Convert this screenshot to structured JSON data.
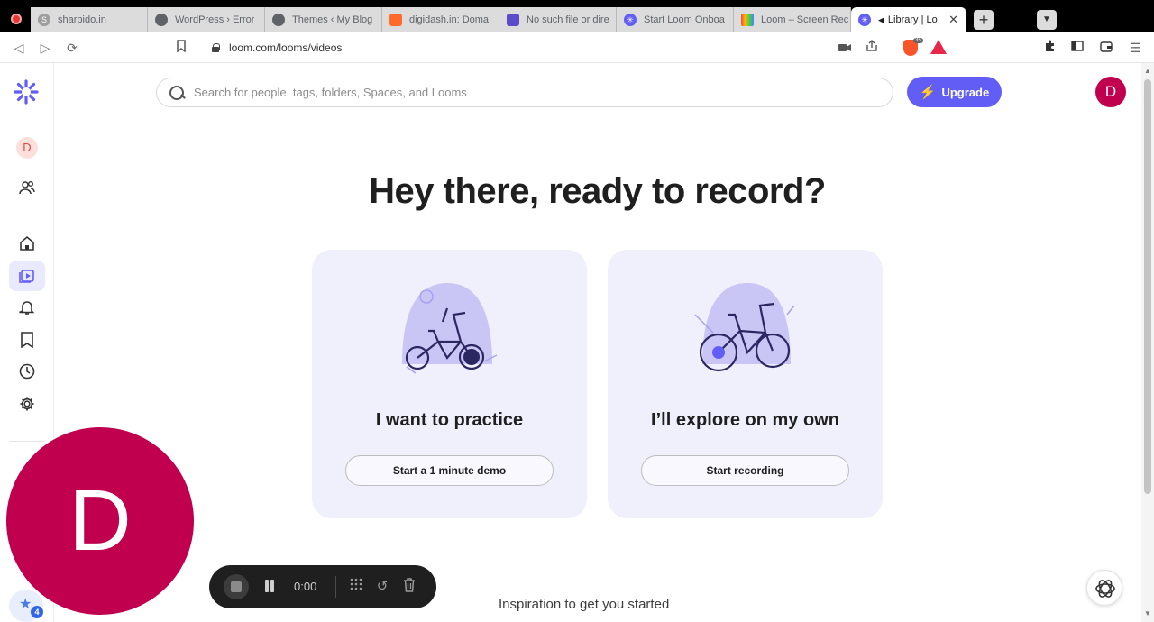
{
  "browser": {
    "tabs": [
      {
        "label": "sharpido.in",
        "icon": "sharpido-icon"
      },
      {
        "label": "WordPress › Error",
        "icon": "globe-icon"
      },
      {
        "label": "Themes ‹ My Blog",
        "icon": "globe-icon"
      },
      {
        "label": "digidash.in: Doma",
        "icon": "digidash-icon"
      },
      {
        "label": "No such file or dire",
        "icon": "chart-icon"
      },
      {
        "label": "Start Loom Onboa",
        "icon": "loom-icon"
      },
      {
        "label": "Loom – Screen Rec",
        "icon": "loom-rainbow-icon"
      },
      {
        "label": "Library | Lo",
        "icon": "loom-icon",
        "active": true
      }
    ],
    "url": "loom.com/looms/videos",
    "brave_shield_count": "35"
  },
  "sidebar": {
    "workspace_initial": "D"
  },
  "search": {
    "placeholder": "Search for people, tags, folders, Spaces, and Looms"
  },
  "header": {
    "upgrade_label": "Upgrade",
    "avatar_initial": "D"
  },
  "main": {
    "headline": "Hey there, ready to record?",
    "cards": [
      {
        "title": "I want to practice",
        "button": "Start a 1 minute demo"
      },
      {
        "title": "I’ll explore on my own",
        "button": "Start recording"
      }
    ],
    "section_title": "Inspiration to get you started"
  },
  "recorder": {
    "camera_initial": "D",
    "timer": "0:00"
  },
  "corner_badge": {
    "count": "4"
  },
  "colors": {
    "brand": "#625df5",
    "avatar": "#c0004e",
    "card_bg": "#f0f0fd"
  }
}
